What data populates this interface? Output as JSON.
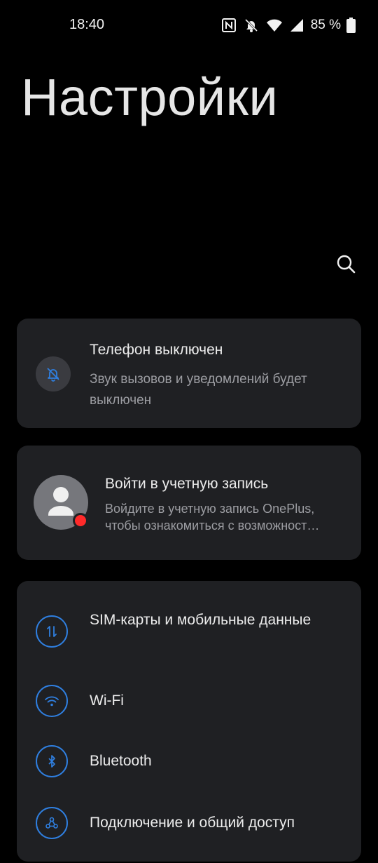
{
  "status_bar": {
    "time": "18:40",
    "battery_percent": "85 %",
    "icons": [
      "nfc-icon",
      "bell-off-icon",
      "wifi-icon",
      "signal-icon",
      "battery-icon"
    ],
    "battery_level": 0.85
  },
  "header": {
    "title": "Настройки",
    "search_icon": "search-icon"
  },
  "dnd_card": {
    "icon": "bell-off-icon",
    "title": "Телефон выключен",
    "subtitle": "Звук вызовов и уведомлений будет выключен"
  },
  "account_card": {
    "icon": "person-icon",
    "title": "Войти в учетную запись",
    "subtitle_line1": "Войдите в учетную запись OnePlus,",
    "subtitle_line2": "чтобы ознакомиться с возможност…"
  },
  "settings_list": {
    "items": [
      {
        "label": "SIM-карты и мобильные данные",
        "icon": "data-arrows-icon"
      },
      {
        "label": "Wi-Fi",
        "icon": "wifi-icon"
      },
      {
        "label": "Bluetooth",
        "icon": "bluetooth-icon"
      },
      {
        "label": "Подключение и общий доступ",
        "icon": "share-icon"
      }
    ]
  },
  "colors": {
    "background": "#000000",
    "card": "#1f2023",
    "accent": "#2f7fe0",
    "notification_dot": "#ff2a2a",
    "secondary_text": "#9c9da2"
  }
}
